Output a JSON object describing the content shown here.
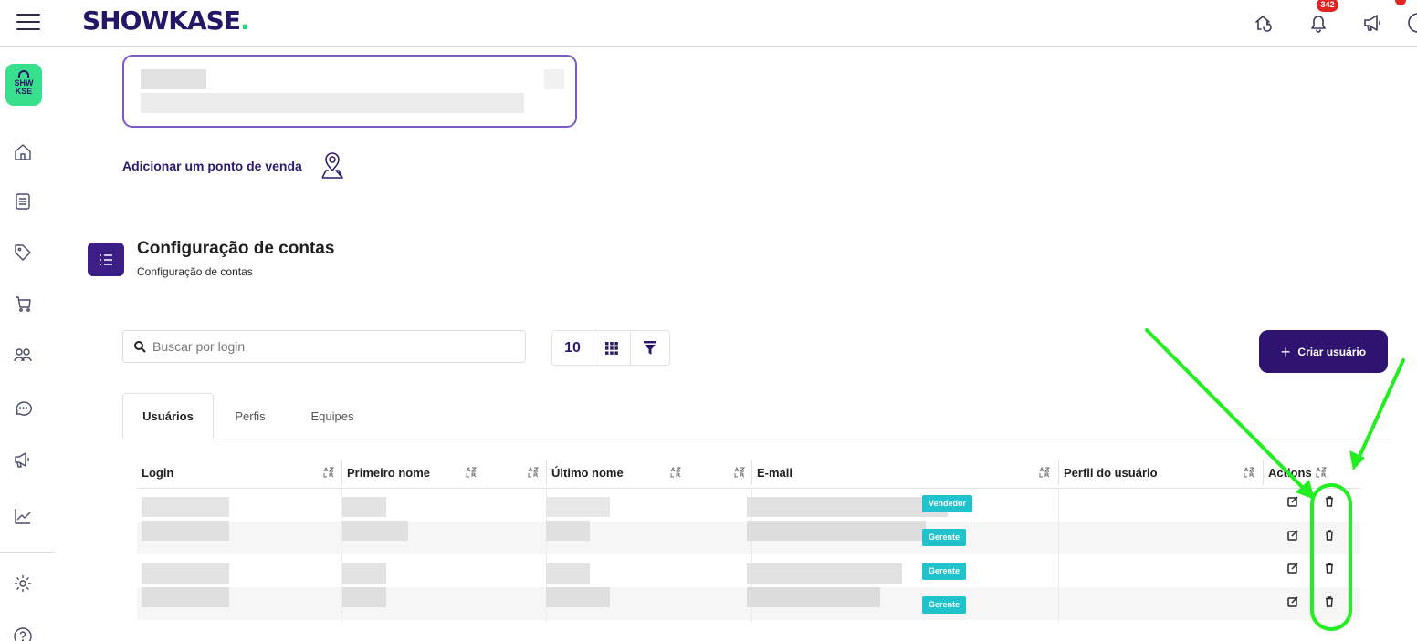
{
  "brand": {
    "name": "SHOWKASE",
    "dot": ".",
    "badge_line1": "SHW",
    "badge_line2": "KSE"
  },
  "header": {
    "notifications_count": "342"
  },
  "add_pos": {
    "label": "Adicionar um ponto de venda"
  },
  "section": {
    "title": "Configuração de contas",
    "subtitle": "Configuração de contas"
  },
  "search": {
    "placeholder": "Buscar por login"
  },
  "toolbar": {
    "page_size": "10"
  },
  "create_button": {
    "label": "Criar usuário",
    "icon": "+"
  },
  "tabs": [
    {
      "label": "Usuários",
      "active": true
    },
    {
      "label": "Perfis",
      "active": false
    },
    {
      "label": "Equipes",
      "active": false
    }
  ],
  "table": {
    "columns": [
      "Login",
      "Primeiro nome",
      "Último nome",
      "E-mail",
      "Perfil do usuário",
      "Actions"
    ],
    "rows": [
      {
        "role": "Vendedor"
      },
      {
        "role": "Gerente"
      },
      {
        "role": "Gerente"
      },
      {
        "role": "Gerente"
      }
    ]
  },
  "colors": {
    "primary": "#2e1470",
    "accent_green": "#22d27a",
    "role_badge": "#20c3cc",
    "annotation": "#22ee22",
    "card_border": "#7c5cc4"
  },
  "icons": {
    "sidebar": [
      "home-icon",
      "checklist-icon",
      "tag-icon",
      "cart-icon",
      "users-icon",
      "chat-icon",
      "megaphone-icon",
      "chart-icon",
      "settings-icon",
      "help-icon"
    ],
    "header": [
      "sync-icon",
      "bell-icon",
      "megaphone-icon",
      "user-icon"
    ],
    "row_actions": [
      "edit-icon",
      "trash-icon"
    ]
  }
}
